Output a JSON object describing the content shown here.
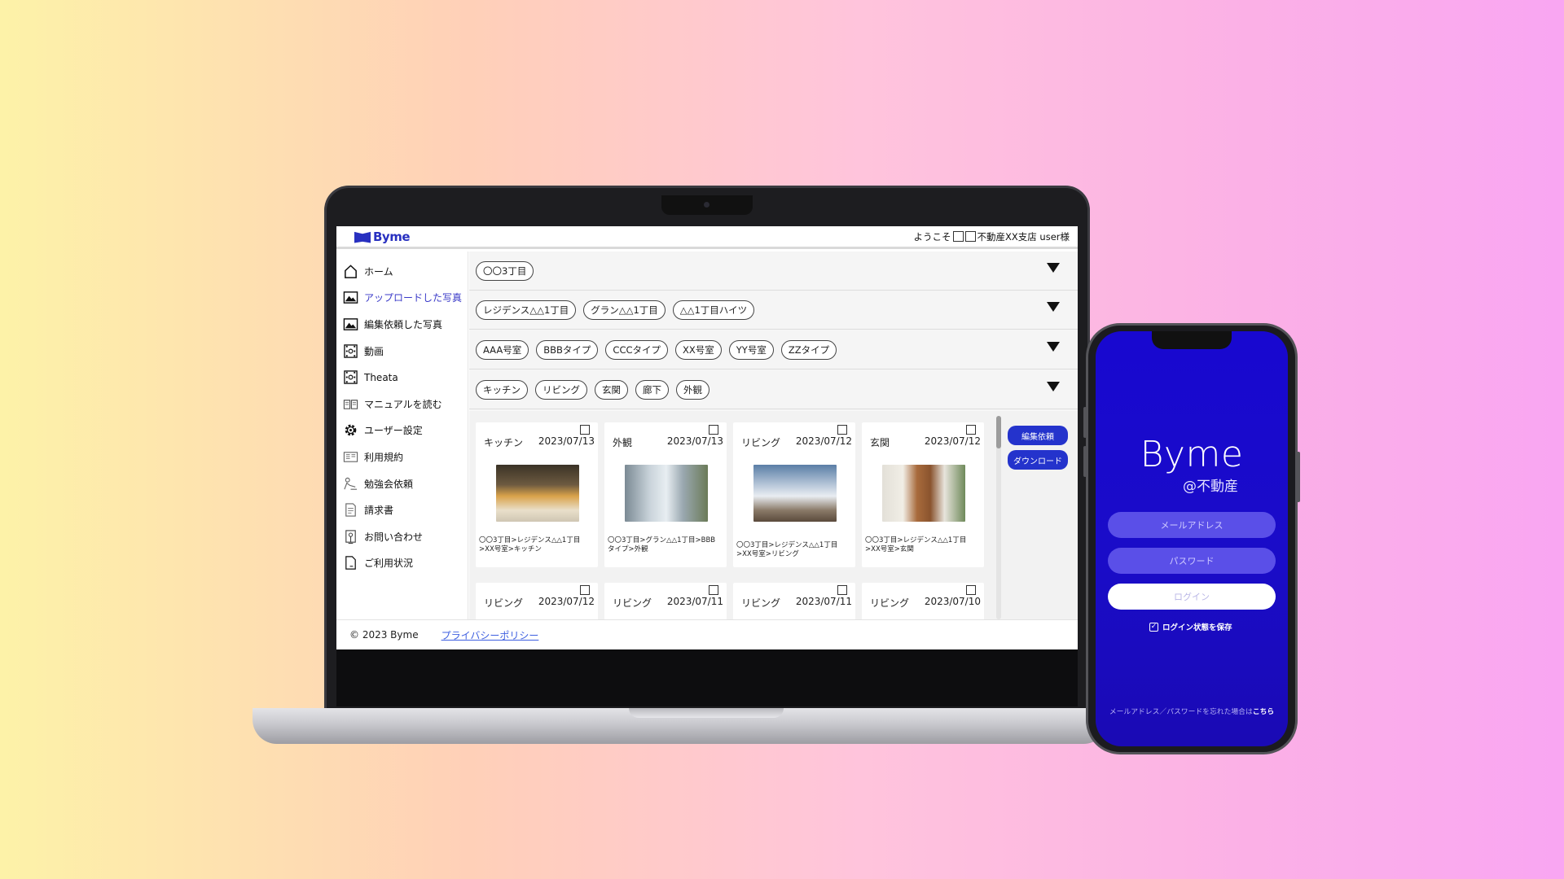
{
  "header": {
    "logo_text": "Byme",
    "welcome_prefix": "ようこそ",
    "welcome_suffix": "不動産XX支店 user様"
  },
  "sidebar": {
    "items": [
      {
        "label": "ホーム",
        "icon": "home-icon",
        "active": false
      },
      {
        "label": "アップロードした写真",
        "icon": "photo-icon",
        "active": true
      },
      {
        "label": "編集依頼した写真",
        "icon": "photo-edit-icon",
        "active": false
      },
      {
        "label": "動画",
        "icon": "video-icon",
        "active": false
      },
      {
        "label": "Theata",
        "icon": "theata-icon",
        "active": false
      },
      {
        "label": "マニュアルを読む",
        "icon": "manual-icon",
        "active": false
      },
      {
        "label": "ユーザー設定",
        "icon": "gear-icon",
        "active": false
      },
      {
        "label": "利用規約",
        "icon": "terms-icon",
        "active": false
      },
      {
        "label": "勉強会依頼",
        "icon": "study-icon",
        "active": false
      },
      {
        "label": "請求書",
        "icon": "invoice-icon",
        "active": false
      },
      {
        "label": "お問い合わせ",
        "icon": "contact-icon",
        "active": false
      },
      {
        "label": "ご利用状況",
        "icon": "usage-icon",
        "active": false
      }
    ]
  },
  "filters": {
    "area": [
      "〇〇3丁目"
    ],
    "buildings": [
      "レジデンス△△1丁目",
      "グラン△△1丁目",
      "△△1丁目ハイツ"
    ],
    "rooms": [
      "AAA号室",
      "BBBタイプ",
      "CCCタイプ",
      "XX号室",
      "YY号室",
      "ZZタイプ"
    ],
    "spots": [
      "キッチン",
      "リビング",
      "玄関",
      "廊下",
      "外観"
    ]
  },
  "photos": [
    {
      "spot": "キッチン",
      "date": "2023/07/13",
      "path": "〇〇3丁目>レジデンス△△1丁目\n>XX号室>キッチン"
    },
    {
      "spot": "外観",
      "date": "2023/07/13",
      "path": "〇〇3丁目>グラン△△1丁目>BBB\nタイプ>外観"
    },
    {
      "spot": "リビング",
      "date": "2023/07/12",
      "path": "〇〇3丁目>レジデンス△△1丁目\n>XX号室>リビング"
    },
    {
      "spot": "玄関",
      "date": "2023/07/12",
      "path": "〇〇3丁目>レジデンス△△1丁目\n>XX号室>玄関"
    },
    {
      "spot": "リビング",
      "date": "2023/07/12",
      "path": ""
    },
    {
      "spot": "リビング",
      "date": "2023/07/11",
      "path": ""
    },
    {
      "spot": "リビング",
      "date": "2023/07/11",
      "path": ""
    },
    {
      "spot": "リビング",
      "date": "2023/07/10",
      "path": ""
    }
  ],
  "actions": {
    "edit_request": "編集依頼",
    "download": "ダウンロード"
  },
  "footer": {
    "copyright": "© 2023 Byme",
    "privacy": "プライバシーポリシー"
  },
  "mobile": {
    "logo": "Byme",
    "subtitle": "@不動産",
    "email_placeholder": "メールアドレス",
    "password_placeholder": "パスワード",
    "login_label": "ログイン",
    "remember_label": "ログイン状態を保存",
    "remember_checked": true,
    "forgot_text": "メールアドレス／パスワードを忘れた場合は",
    "forgot_link": "こちら"
  },
  "colors": {
    "brand": "#2830c0",
    "accent_button": "#2433cc",
    "active_nav": "#3a3ac8",
    "mobile_bg": "#1808d0"
  }
}
